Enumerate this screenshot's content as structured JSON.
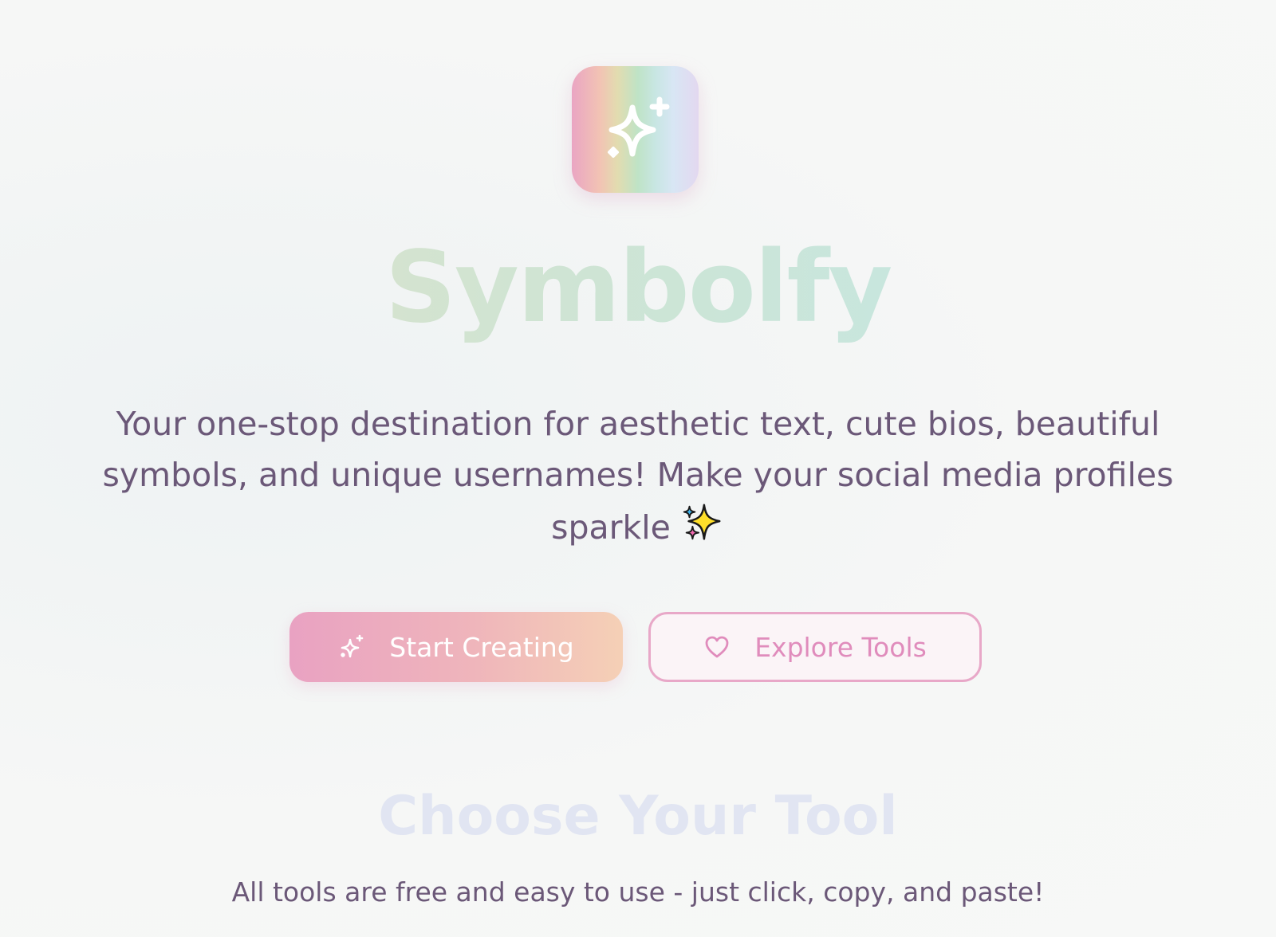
{
  "hero": {
    "logo_icon": "sparkles-icon",
    "brand_name": "Symbolfy",
    "tagline": "Your one-stop destination for aesthetic text, cute bios, beautiful symbols, and unique usernames! Make your social media profiles sparkle",
    "tagline_emoji": "sparkles-emoji"
  },
  "actions": {
    "primary": {
      "label": "Start Creating",
      "icon": "sparkles-icon"
    },
    "secondary": {
      "label": "Explore Tools",
      "icon": "heart-icon"
    }
  },
  "tools_section": {
    "title": "Choose Your Tool",
    "subtitle": "All tools are free and easy to use - just click, copy, and paste!"
  },
  "colors": {
    "primary_gradient_start": "#e9a2c2",
    "primary_gradient_end": "#f5d0b6",
    "accent_pink": "#e08cbc",
    "text": "#6b5878"
  }
}
